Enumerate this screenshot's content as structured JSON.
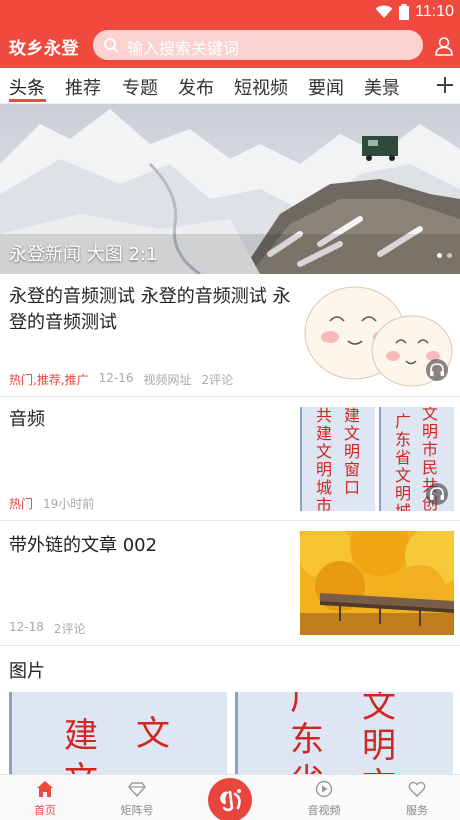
{
  "status_bar": {
    "time": "11:10"
  },
  "header": {
    "app_title": "玫乡永登",
    "search_placeholder": "输入搜索关键词"
  },
  "tabs": [
    "头条",
    "推荐",
    "专题",
    "发布",
    "短视频",
    "要闻",
    "美景"
  ],
  "banner": {
    "caption": "永登新闻  大图 2:1"
  },
  "news": [
    {
      "title": "永登的音频测试 永登的音频测试 永登的音频测试",
      "tags": "热门,推荐,推广",
      "date": "12-16",
      "source": "视频网址",
      "comments": "2评论"
    },
    {
      "title": "音频",
      "tags": "热门",
      "time": "19小时前"
    },
    {
      "title": "带外链的文章 002",
      "date": "12-18",
      "comments": "2评论"
    }
  ],
  "thumb_text": {
    "col1": "共建文明城市",
    "col2": "建文明窗口",
    "col3": "广东省文明城市",
    "col4": "文明市民 共创"
  },
  "gallery": {
    "title": "图片",
    "left_text": [
      "建",
      "文",
      "文"
    ],
    "right_text": [
      "广",
      "文",
      "东",
      "明",
      "省",
      "市"
    ]
  },
  "bottom_nav": [
    "首页",
    "矩阵号",
    "音视频",
    "服务"
  ],
  "colors": {
    "brand": "#f04a3f",
    "tag": "#e8453c"
  }
}
